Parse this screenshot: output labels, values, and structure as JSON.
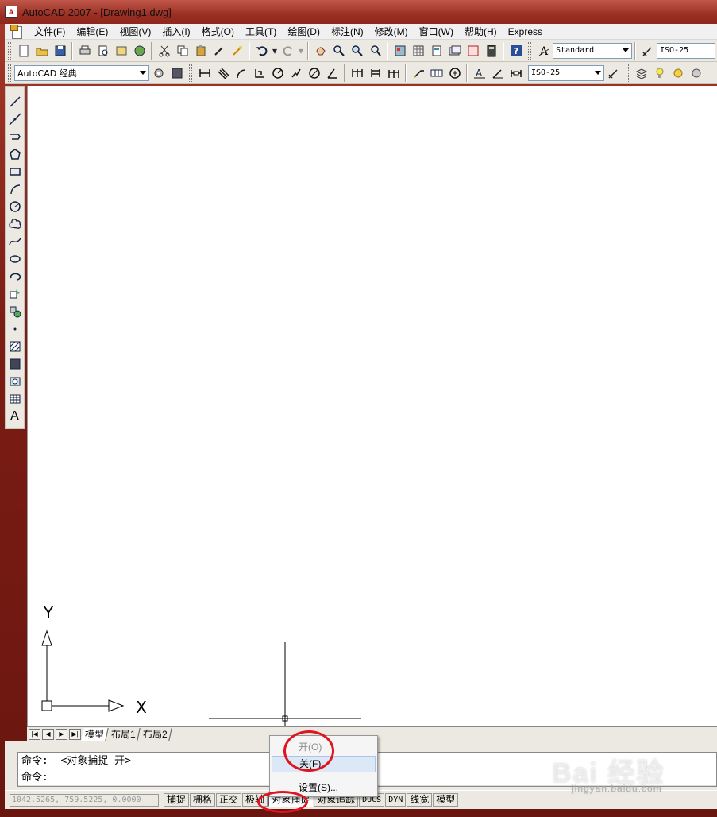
{
  "window": {
    "title": "AutoCAD 2007 - [Drawing1.dwg]"
  },
  "menubar": {
    "items": [
      "文件(F)",
      "编辑(E)",
      "视图(V)",
      "插入(I)",
      "格式(O)",
      "工具(T)",
      "绘图(D)",
      "标注(N)",
      "修改(M)",
      "窗口(W)",
      "帮助(H)",
      "Express"
    ]
  },
  "toolbar": {
    "text_style": "Standard",
    "dim_style_top": "ISO-25",
    "workspace": "AutoCAD 经典",
    "dim_style_bottom": "ISO-25"
  },
  "canvas": {
    "ucs_y_label": "Y",
    "ucs_x_label": "X"
  },
  "layout_tabs": [
    "模型",
    "布局1",
    "布局2"
  ],
  "command": {
    "line1": "命令:  <对象捕捉 开>",
    "line2": "命令:"
  },
  "statusbar": {
    "coords": "1042.5265, 759.5225, 0.0000",
    "buttons": [
      "捕捉",
      "栅格",
      "正交",
      "极轴",
      "对象捕捉",
      "对象追踪",
      "DUCS",
      "DYN",
      "线宽",
      "模型"
    ]
  },
  "context_menu": {
    "on_label": "开(O)",
    "off_label": "关(F)",
    "settings_label": "设置(S)..."
  },
  "watermark": {
    "brand": "Bai 经验",
    "url": "jingyan.baidu.com"
  },
  "colors": {
    "title_bar": "#9c2f23",
    "annotation_red": "#e0141e",
    "highlight": "#dce8f5"
  }
}
